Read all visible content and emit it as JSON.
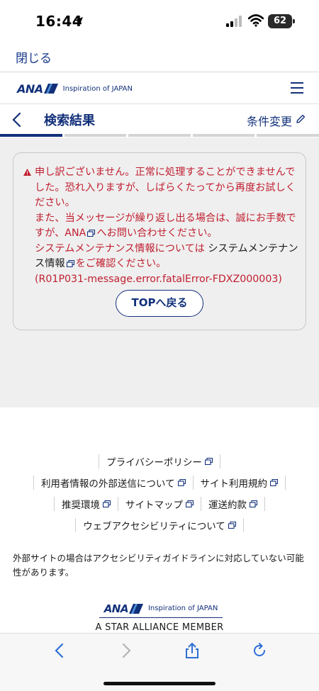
{
  "status_bar": {
    "time": "16:44",
    "battery": "62"
  },
  "close_bar": {
    "close_label": "閉じる"
  },
  "header": {
    "logo_text": "ANA",
    "logo_tagline": "Inspiration of JAPAN"
  },
  "results_bar": {
    "title": "検索結果",
    "condition_change": "条件変更",
    "progress_steps": 5,
    "active_step": 1
  },
  "error": {
    "line1": "申し訳ございません。正常に処理することができませんでした。恐れ入りますが、しばらくたってから再度お試しください。",
    "line2a": "また、当メッセージが繰り返し出る場合は、誠にお手数ですが、ANA",
    "line2b": "へお問い合わせください。",
    "line3a": "システムメンテナンス情報については",
    "line3_link": "システムメンテナンス情報",
    "line3b": "をご確認ください。",
    "code": "(R01P031-message.error.fatalError-FDXZ000003)",
    "button_label": "TOPへ戻る"
  },
  "footer": {
    "links": {
      "privacy": "プライバシーポリシー",
      "external_transmission": "利用者情報の外部送信について",
      "terms": "サイト利用規約",
      "env": "推奨環境",
      "sitemap": "サイトマップ",
      "carriage": "運送約款",
      "accessibility": "ウェブアクセシビリティについて"
    },
    "note": "外部サイトの場合はアクセシビリティガイドラインに対応していない可能性があります。",
    "logo_text": "ANA",
    "logo_tagline": "Inspiration of JAPAN",
    "star_alliance": "A STAR ALLIANCE MEMBER"
  },
  "colors": {
    "brand_navy": "#12307a",
    "error_red": "#c01f30",
    "page_gray": "#efefef"
  }
}
